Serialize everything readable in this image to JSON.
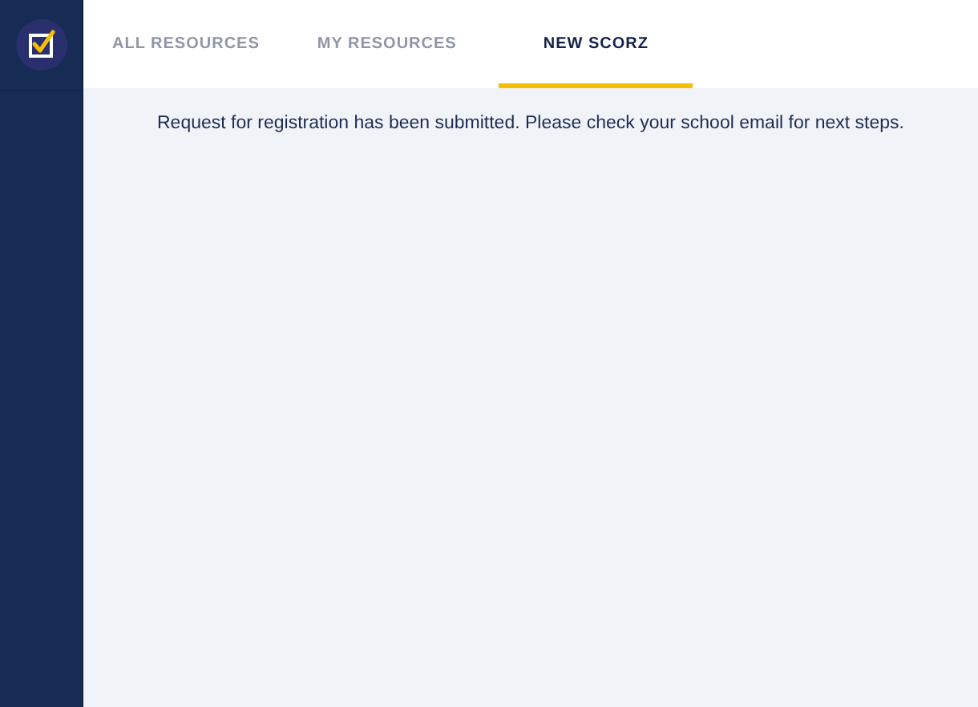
{
  "tabs": [
    {
      "label": "ALL RESOURCES",
      "selected": false
    },
    {
      "label": "MY RESOURCES",
      "selected": false
    },
    {
      "label": "NEW SCORZ",
      "selected": true
    }
  ],
  "message": "Request for registration has been submitted. Please check your school email for next steps."
}
